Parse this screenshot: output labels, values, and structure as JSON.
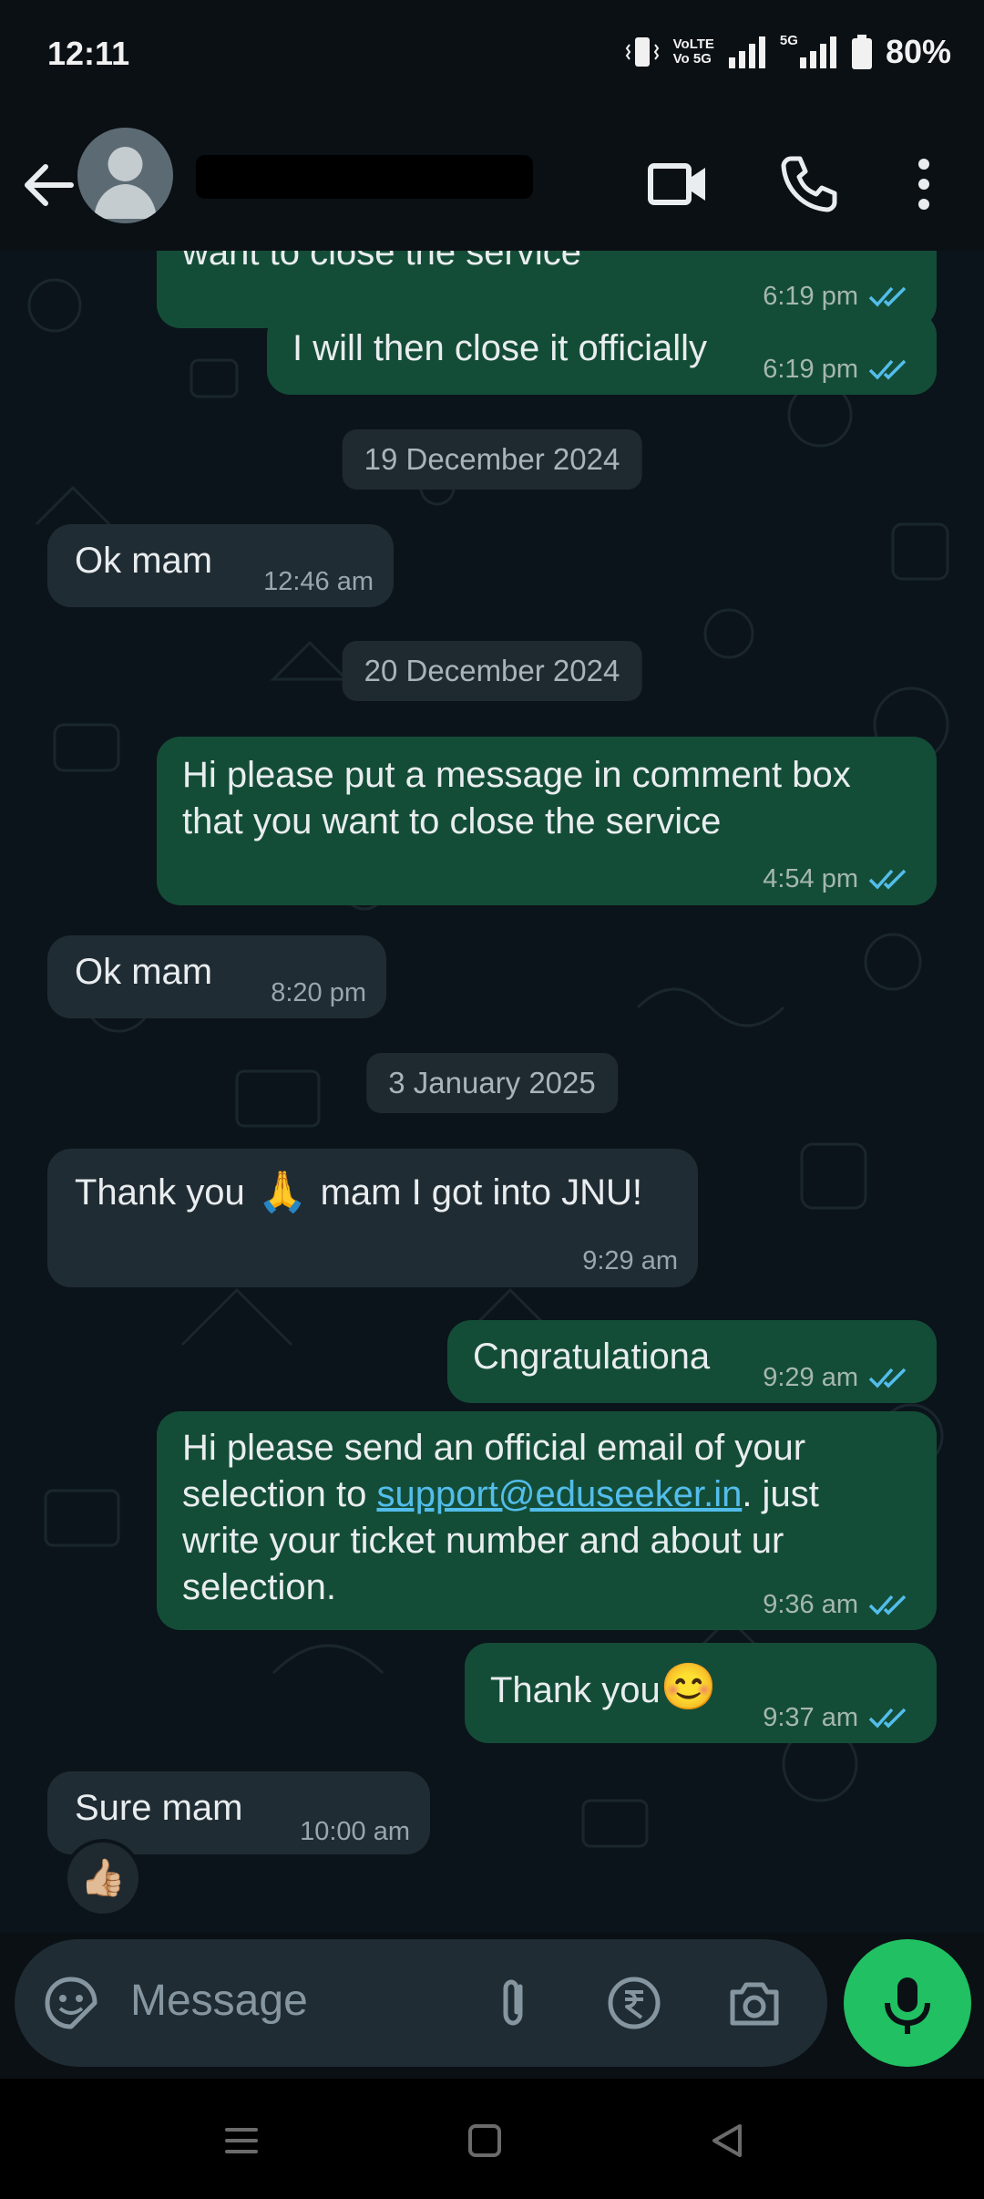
{
  "status_bar": {
    "time": "12:11",
    "network_top": "VoLTE",
    "network_bottom": "Vo 5G",
    "five_g": "5G",
    "battery": "80%"
  },
  "header": {
    "contact_name_redacted": true,
    "icons": [
      "back-arrow-icon",
      "video-call-icon",
      "phone-icon",
      "more-vert-icon"
    ]
  },
  "messages": [
    {
      "dir": "out",
      "text": "want to close the service",
      "time": "6:19 pm",
      "status": "read"
    },
    {
      "dir": "out",
      "text": "I will then close it officially",
      "time": "6:19 pm",
      "status": "read"
    },
    {
      "type": "date",
      "text": "19 December 2024"
    },
    {
      "dir": "in",
      "text": "Ok mam",
      "time": "12:46 am"
    },
    {
      "type": "date",
      "text": "20 December 2024"
    },
    {
      "dir": "out",
      "lines": [
        "Hi please put a message in comment box",
        "that you want to close the service"
      ],
      "time": "4:54 pm",
      "status": "read"
    },
    {
      "dir": "in",
      "text": "Ok mam",
      "time": "8:20 pm"
    },
    {
      "type": "date",
      "text": "3 January 2025"
    },
    {
      "dir": "in",
      "text_before": "Thank you",
      "emoji": "🙏",
      "text_after": "mam I got into JNU!",
      "time": "9:29 am"
    },
    {
      "dir": "out",
      "text": "Cngratulationa",
      "time": "9:29 am",
      "status": "read"
    },
    {
      "dir": "out",
      "line1": "Hi please send an official email of your",
      "line2_before": "selection to ",
      "link": "support@eduseeker.in",
      "line2_after": ". just",
      "line3": "write your ticket number and about ur",
      "line4": "selection.",
      "time": "9:36 am",
      "status": "read"
    },
    {
      "dir": "out",
      "text": "Thank you",
      "emoji": "😊",
      "time": "9:37 am",
      "status": "read"
    },
    {
      "dir": "in",
      "text": "Sure mam",
      "time": "10:00 am",
      "reaction": "👍🏼"
    }
  ],
  "composer": {
    "placeholder": "Message",
    "icons": [
      "sticker-icon",
      "attach-icon",
      "rupee-payment-icon",
      "camera-icon",
      "mic-icon"
    ]
  },
  "nav_bar": {
    "icons": [
      "recents-icon",
      "home-icon",
      "back-icon"
    ]
  },
  "colors": {
    "outgoing_bubble": "#144d37",
    "incoming_bubble": "#202c33",
    "read_ticks": "#53bdeb",
    "mic_button": "#21c063",
    "background": "#0b141a"
  }
}
